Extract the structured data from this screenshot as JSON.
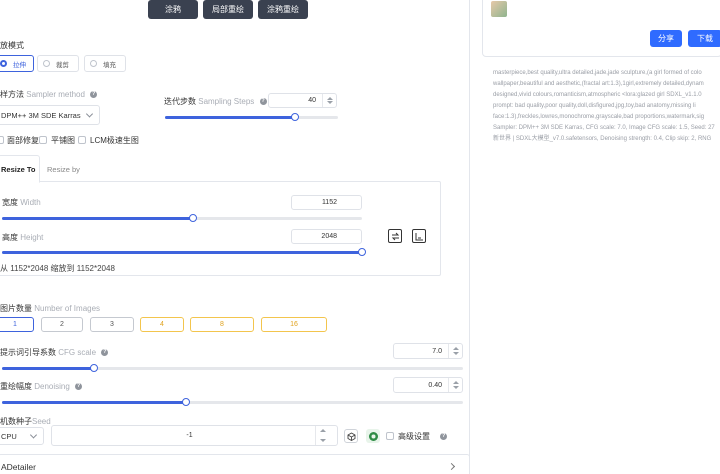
{
  "top_buttons": [
    "涂鸦",
    "局部重绘",
    "涂鸦重绘"
  ],
  "mode": {
    "label": "放模式",
    "options": [
      "拉伸",
      "裁剪",
      "填充"
    ],
    "selected": "拉伸"
  },
  "sampler": {
    "label_cn": "样方法",
    "label_en": "Sampler method",
    "value": "DPM++ 3M SDE Karras"
  },
  "steps": {
    "label_cn": "迭代步数",
    "label_en": "Sampling Steps",
    "value": "40",
    "fraction": 0.75
  },
  "options": [
    "面部修复",
    "平铺图",
    "LCM极速生图"
  ],
  "resize_tabs": [
    "Resize To",
    "Resize by"
  ],
  "width": {
    "label_cn": "宽度",
    "label_en": "Width",
    "value": "1152",
    "fraction": 0.53
  },
  "height": {
    "label_cn": "高度",
    "label_en": "Height",
    "value": "2048",
    "fraction": 1.0
  },
  "scale_note": "从 1152*2048 缩放到 1152*2048",
  "image_count": {
    "label_cn": "图片数量",
    "label_en": "Number of Images",
    "options": [
      "1",
      "2",
      "3",
      "4",
      "8",
      "16"
    ],
    "selected": "1"
  },
  "cfg": {
    "label_cn": "提示词引导系数",
    "label_en": "CFG scale",
    "value": "7.0",
    "fraction": 0.2
  },
  "denoise": {
    "label_cn": "重绘幅度",
    "label_en": "Denoising",
    "value": "0.40",
    "fraction": 0.4
  },
  "seed": {
    "label_cn": "机数种子",
    "label_en": "Seed",
    "device": "CPU",
    "value": "-1",
    "advanced_label": "高级设置"
  },
  "adetailer": {
    "label": "ADetailer"
  },
  "right": {
    "share_label": "分享",
    "download_label": "下载",
    "meta_lines": [
      "masterpiece,best quality,ultra detailed,jade,jade sculpture,(a girl formed of colo",
      "wallpaper,beautiful and aesthetic,(fractal art:1.3),1girl,extremely detailed,dynam",
      "designed,vivid colours,romanticism,atmospheric <lora:glazed girl SDXL_v1.1.0",
      "prompt: bad quality,poor quality,doll,disfigured,jpg,toy,bad anatomy,missing li",
      "face:1.3),freckles,lowres,monochrome,grayscale,bad proportions,watermark,sig",
      "Sampler: DPM++ 3M SDE Karras, CFG scale: 7.0, Image CFG scale: 1.5, Seed: 27",
      "新世界 | SDXL大模型_v7.0.safetensors, Denoising strength: 0.4, Clip skip: 2, RNG"
    ]
  },
  "colors": {
    "accent": "#3e63dd",
    "warn": "#f3c54d",
    "share_button": "#2f6bff",
    "dark_button": "#3a4150"
  }
}
